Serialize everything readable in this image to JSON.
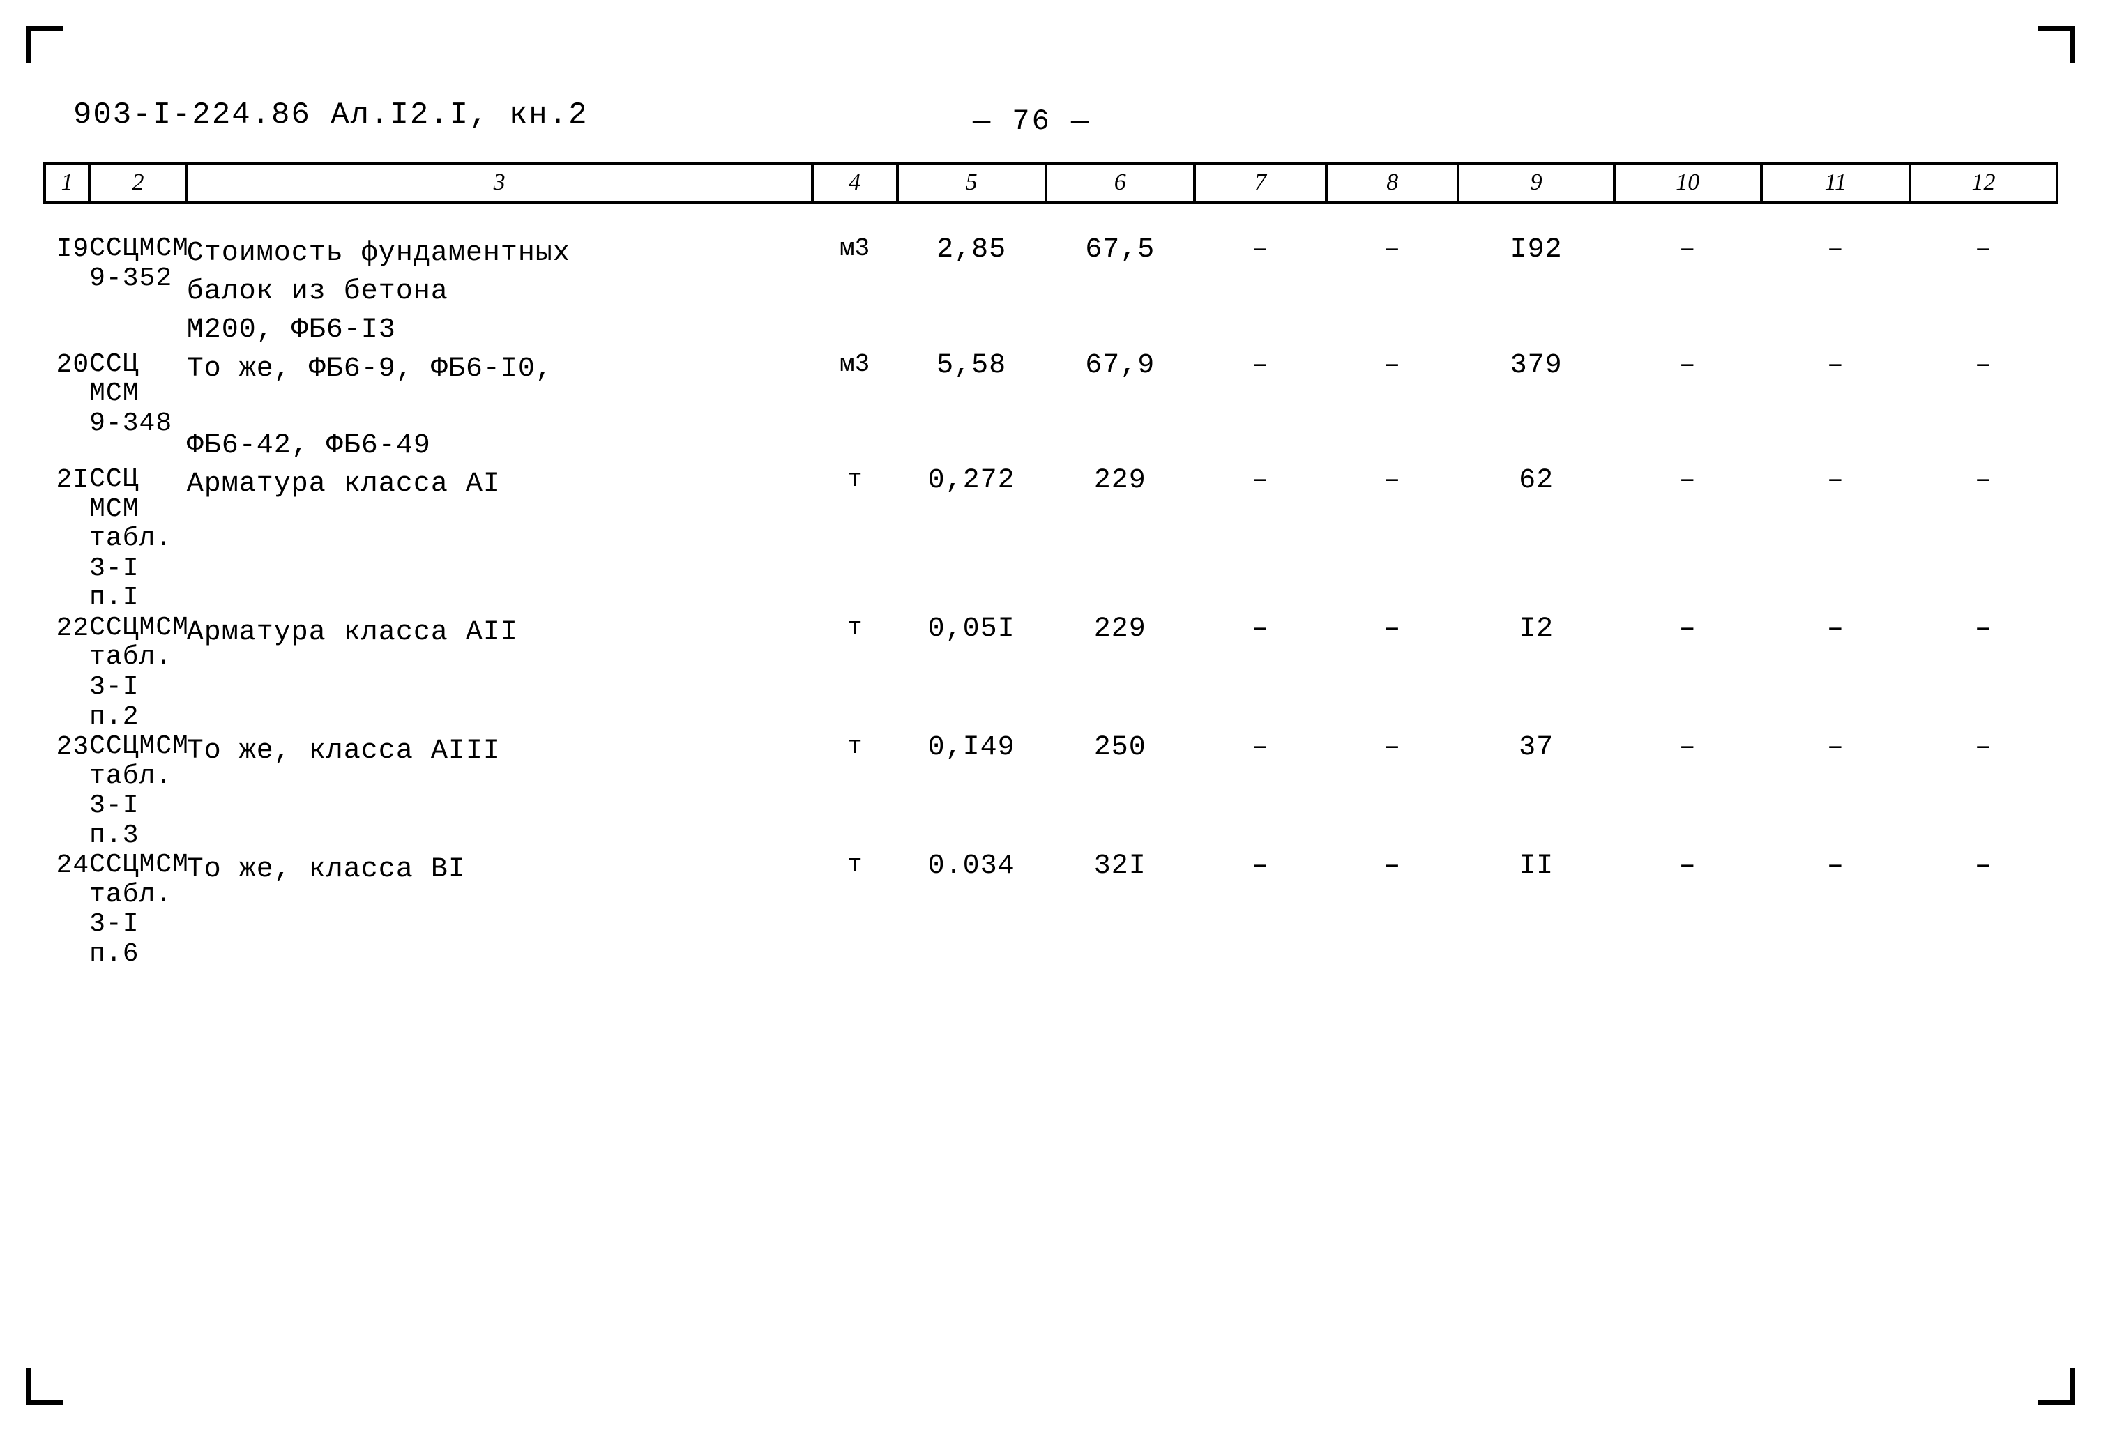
{
  "document": {
    "header_code": "903-I-224.86   Ал.I2.I, кн.2",
    "page_label": "— 76 —"
  },
  "table": {
    "column_headers": [
      "1",
      "2",
      "3",
      "4",
      "5",
      "6",
      "7",
      "8",
      "9",
      "10",
      "11",
      "12"
    ],
    "rows": [
      {
        "pos": "I9",
        "code": "ССЦМСМ\n9-352",
        "description": "Стоимость фундаментных\nбалок из бетона\nМ200, ФБ6-I3",
        "unit": "м3",
        "col5": "2,85",
        "col6": "67,5",
        "col7": "–",
        "col8": "–",
        "col9": "I92",
        "col10": "–",
        "col11": "–",
        "col12": "–"
      },
      {
        "pos": "20",
        "code": "ССЦ\nМСМ\n9-348",
        "description": "То же, ФБ6-9, ФБ6-I0,\n\nФБ6-42, ФБ6-49",
        "unit": "м3",
        "col5": "5,58",
        "col6": "67,9",
        "col7": "–",
        "col8": "–",
        "col9": "379",
        "col10": "–",
        "col11": "–",
        "col12": "–"
      },
      {
        "pos": "2I",
        "code": "ССЦ\nМСМ\nтабл.\n3-I\nп.I",
        "description": "Арматура класса АI",
        "unit": "т",
        "col5": "0,272",
        "col6": "229",
        "col7": "–",
        "col8": "–",
        "col9": "62",
        "col10": "–",
        "col11": "–",
        "col12": "–"
      },
      {
        "pos": "22",
        "code": "ССЦМСМ\nтабл.\n3-I\nп.2",
        "description": "Арматура класса АII",
        "unit": "т",
        "col5": "0,05I",
        "col6": "229",
        "col7": "–",
        "col8": "–",
        "col9": "I2",
        "col10": "–",
        "col11": "–",
        "col12": "–"
      },
      {
        "pos": "23",
        "code": "ССЦМСМ\nтабл.\n3-I\nп.3",
        "description": "То же, класса АIII",
        "unit": "т",
        "col5": "0,I49",
        "col6": "250",
        "col7": "–",
        "col8": "–",
        "col9": "37",
        "col10": "–",
        "col11": "–",
        "col12": "–"
      },
      {
        "pos": "24",
        "code": "ССЦМСМ\nтабл.\n3-I\nп.6",
        "description": "То же, класса ВI",
        "unit": "т",
        "col5": "0.034",
        "col6": "32I",
        "col7": "–",
        "col8": "–",
        "col9": "II",
        "col10": "–",
        "col11": "–",
        "col12": "–"
      }
    ]
  }
}
